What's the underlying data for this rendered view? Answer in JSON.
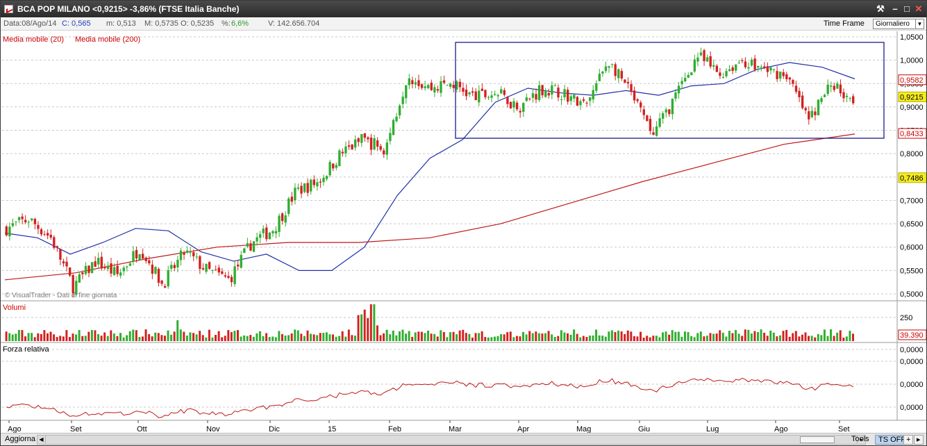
{
  "window": {
    "title": "BCA POP MILANO <0,9215> -3,86%  (FTSE Italia Banche)",
    "buttons": [
      "⚒",
      "–",
      "□",
      "✕"
    ]
  },
  "infobar": {
    "date": "Data:08/Ago/14",
    "close": "C: 0,565",
    "min": "m: 0,513",
    "max_open": "M: 0,5735  O: 0,5235",
    "pct_label": "%:",
    "pct_value": "6,6%",
    "volume": "V: 142.656.704",
    "time_frame_label": "Time Frame",
    "time_frame_value": "Giornaliero"
  },
  "legend": {
    "ma20": "Media mobile (20)",
    "ma200": "Media mobile (200)"
  },
  "watermark": "© VisualTrader - Dati di fine giornata",
  "panels": {
    "volume_label": "Volumi",
    "rsi_label": "Forza relativa",
    "volume_tick": "250",
    "volume_badge": "39.390"
  },
  "price_axis": {
    "ticks": [
      "1,0500",
      "1,0000",
      "0,9500",
      "0,9000",
      "0,8500",
      "0,8000",
      "0,7500",
      "0,7000",
      "0,6500",
      "0,6000",
      "0,5500",
      "0,5000"
    ],
    "badges": [
      {
        "text": "0,9582",
        "value": 0.9582,
        "bg": "#ffffff",
        "border": "#cc0000",
        "color": "#cc0000"
      },
      {
        "text": "0,9215",
        "value": 0.9215,
        "bg": "#f4ec20",
        "border": "#bbb000",
        "color": "#000000"
      },
      {
        "text": "0,8433",
        "value": 0.8433,
        "bg": "#ffffff",
        "border": "#cc0000",
        "color": "#cc0000"
      },
      {
        "text": "0,7486",
        "value": 0.7486,
        "bg": "#f4ec20",
        "border": "#bbb000",
        "color": "#000000"
      }
    ]
  },
  "rsi_axis": {
    "ticks": [
      "0,0000",
      "0,0000",
      "0,0000",
      "0,0000"
    ]
  },
  "x_axis": {
    "labels": [
      "Ago",
      "Set",
      "Ott",
      "Nov",
      "Dic",
      "15",
      "Feb",
      "Mar",
      "Apr",
      "Mag",
      "Giu",
      "Lug",
      "Ago",
      "Set"
    ]
  },
  "bottombar": {
    "refresh": "Aggiorna",
    "tools": "Tools",
    "ts": "TS OFF",
    "plus": "+",
    "arrow": "▸"
  },
  "colors": {
    "up_candle": "#2fae2f",
    "down_candle": "#d42020",
    "ma20": "#1f2fa8",
    "ma200": "#c01818",
    "box": "#1a1a8c",
    "grid": "#c8c8c8"
  },
  "chart_data": {
    "type": "candlestick",
    "title": "BCA POP MILANO",
    "ylim": [
      0.49,
      1.06
    ],
    "x": [
      "Ago",
      "Set",
      "Ott",
      "Nov",
      "Dic",
      "15",
      "Feb",
      "Mar",
      "Apr",
      "Mag",
      "Giu",
      "Lug",
      "Ago",
      "Set"
    ],
    "anchors_price": [
      0.64,
      0.66,
      0.62,
      0.515,
      0.57,
      0.54,
      0.6,
      0.52,
      0.59,
      0.55,
      0.53,
      0.61,
      0.64,
      0.72,
      0.74,
      0.8,
      0.83,
      0.81,
      0.97,
      0.94,
      0.95,
      0.92,
      0.93,
      0.9,
      0.94,
      0.93,
      0.9,
      1.0,
      0.93,
      0.84,
      0.92,
      1.01,
      0.97,
      1.0,
      0.98,
      0.97,
      0.87,
      0.95,
      0.92
    ],
    "series": [
      {
        "name": "Media mobile (20)",
        "values": [
          0.63,
          0.62,
          0.585,
          0.61,
          0.64,
          0.635,
          0.59,
          0.57,
          0.585,
          0.55,
          0.55,
          0.6,
          0.71,
          0.79,
          0.83,
          0.91,
          0.94,
          0.93,
          0.925,
          0.935,
          0.925,
          0.945,
          0.95,
          0.98,
          0.995,
          0.985,
          0.96
        ]
      },
      {
        "name": "Media mobile (200)",
        "values": [
          0.53,
          0.545,
          0.575,
          0.6,
          0.61,
          0.61,
          0.62,
          0.65,
          0.695,
          0.74,
          0.78,
          0.82,
          0.842
        ]
      }
    ],
    "volume_note": "Volumi",
    "rsi_note": "Forza relativa"
  }
}
